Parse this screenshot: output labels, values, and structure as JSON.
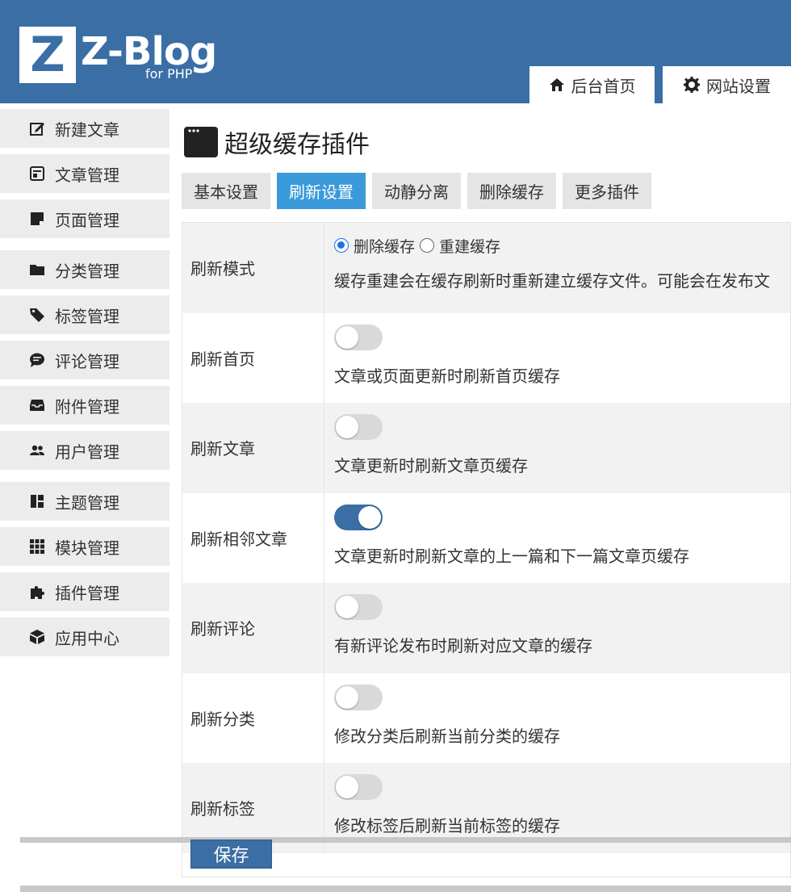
{
  "header": {
    "logo_letter": "Z",
    "brand": "Z-Blog",
    "brand_sub": "for PHP",
    "tabs": [
      {
        "label": "后台首页",
        "icon": "home-icon"
      },
      {
        "label": "网站设置",
        "icon": "gear-icon"
      }
    ],
    "color": "#3a6ea5"
  },
  "sidebar": {
    "items": [
      {
        "label": "新建文章",
        "icon": "edit-icon"
      },
      {
        "label": "文章管理",
        "icon": "articles-icon"
      },
      {
        "label": "页面管理",
        "icon": "page-icon"
      },
      {
        "label": "分类管理",
        "icon": "folder-icon"
      },
      {
        "label": "标签管理",
        "icon": "tag-icon"
      },
      {
        "label": "评论管理",
        "icon": "comment-icon"
      },
      {
        "label": "附件管理",
        "icon": "inbox-icon"
      },
      {
        "label": "用户管理",
        "icon": "users-icon"
      },
      {
        "label": "主题管理",
        "icon": "theme-icon"
      },
      {
        "label": "模块管理",
        "icon": "grid-icon"
      },
      {
        "label": "插件管理",
        "icon": "puzzle-icon"
      },
      {
        "label": "应用中心",
        "icon": "box-icon"
      }
    ]
  },
  "main": {
    "title": "超级缓存插件",
    "title_icon": "window-icon",
    "tabs": [
      {
        "label": "基本设置",
        "active": false
      },
      {
        "label": "刷新设置",
        "active": true
      },
      {
        "label": "动静分离",
        "active": false
      },
      {
        "label": "删除缓存",
        "active": false
      },
      {
        "label": "更多插件",
        "active": false
      }
    ],
    "active_color": "#3a9ad9",
    "rows": [
      {
        "label": "刷新模式",
        "type": "radio",
        "options": [
          "删除缓存",
          "重建缓存"
        ],
        "selected": "删除缓存",
        "desc": "缓存重建会在缓存刷新时重新建立缓存文件。可能会在发布文"
      },
      {
        "label": "刷新首页",
        "type": "switch",
        "on": false,
        "desc": "文章或页面更新时刷新首页缓存"
      },
      {
        "label": "刷新文章",
        "type": "switch",
        "on": false,
        "desc": "文章更新时刷新文章页缓存"
      },
      {
        "label": "刷新相邻文章",
        "type": "switch",
        "on": true,
        "desc": "文章更新时刷新文章的上一篇和下一篇文章页缓存"
      },
      {
        "label": "刷新评论",
        "type": "switch",
        "on": false,
        "desc": "有新评论发布时刷新对应文章的缓存"
      },
      {
        "label": "刷新分类",
        "type": "switch",
        "on": false,
        "desc": "修改分类后刷新当前分类的缓存"
      },
      {
        "label": "刷新标签",
        "type": "switch",
        "on": false,
        "desc": "修改标签后刷新当前标签的缓存"
      }
    ],
    "save_label": "保存"
  }
}
